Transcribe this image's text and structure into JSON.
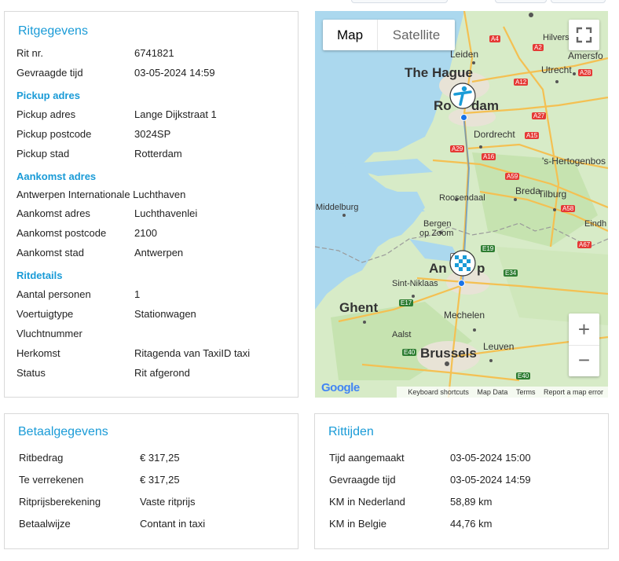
{
  "ritgegevens": {
    "title": "Ritgegevens",
    "rit_nr_label": "Rit nr.",
    "rit_nr": "6741821",
    "gevraagde_tijd_label": "Gevraagde tijd",
    "gevraagde_tijd": "03-05-2024 14:59",
    "pickup_heading": "Pickup adres",
    "pickup_adres_label": "Pickup adres",
    "pickup_adres": "Lange Dijkstraat 1",
    "pickup_postcode_label": "Pickup postcode",
    "pickup_postcode": "3024SP",
    "pickup_stad_label": "Pickup stad",
    "pickup_stad": "Rotterdam",
    "aankomst_heading": "Aankomst adres",
    "aankomst_naam": "Antwerpen Internationale Luchthaven",
    "aankomst_adres_label": "Aankomst adres",
    "aankomst_adres": "Luchthavenlei",
    "aankomst_postcode_label": "Aankomst postcode",
    "aankomst_postcode": "2100",
    "aankomst_stad_label": "Aankomst stad",
    "aankomst_stad": "Antwerpen",
    "ritdetails_heading": "Ritdetails",
    "aantal_personen_label": "Aantal personen",
    "aantal_personen": "1",
    "voertuigtype_label": "Voertuigtype",
    "voertuigtype": "Stationwagen",
    "vluchtnummer_label": "Vluchtnummer",
    "vluchtnummer": "",
    "herkomst_label": "Herkomst",
    "herkomst": "Ritagenda van TaxiID taxi",
    "status_label": "Status",
    "status": "Rit afgerond"
  },
  "map": {
    "map_button": "Map",
    "satellite_button": "Satellite",
    "fullscreen_icon": "fullscreen-icon",
    "zoom_in": "+",
    "zoom_out": "−",
    "google_logo": "Google",
    "attribution": [
      "Keyboard shortcuts",
      "Map Data",
      "Terms",
      "Report a map error"
    ],
    "labels": {
      "leiden": "Leiden",
      "the_hague": "The Hague",
      "rotterdam_a": "Ro",
      "rotterdam_b": "dam",
      "dordrecht": "Dordrecht",
      "utrecht": "Utrecht",
      "hilversum": "Hilvers",
      "amersfoort": "Amersfo",
      "hertogenbosch": "'s-Hertogenbos",
      "breda": "Breda",
      "tilburg": "Tilburg",
      "middelburg": "Middelburg",
      "roosendaal": "Roosendaal",
      "bergen": "Bergen",
      "op_zoom": "op Zoom",
      "eindhoven": "Eindh",
      "antwerp_a": "An",
      "antwerp_b": "p",
      "sint_niklaas": "Sint-Niklaas",
      "ghent": "Ghent",
      "mechelen": "Mechelen",
      "aalst": "Aalst",
      "brussels": "Brussels",
      "leuven": "Leuven"
    },
    "shields": [
      "A4",
      "A2",
      "A12",
      "A27",
      "A28",
      "A15",
      "A29",
      "A16",
      "A59",
      "A58",
      "A67",
      "E19",
      "E34",
      "E17",
      "E40",
      "E40",
      "A1"
    ],
    "pickup_marker_icon": "taxi-person-icon",
    "dest_marker_icon": "checkered-flag-icon"
  },
  "betaalgegevens": {
    "title": "Betaalgegevens",
    "ritbedrag_label": "Ritbedrag",
    "ritbedrag": "€ 317,25",
    "te_verrekenen_label": "Te verrekenen",
    "te_verrekenen": "€ 317,25",
    "ritprijs_label": "Ritprijsberekening",
    "ritprijs": "Vaste ritprijs",
    "betaalwijze_label": "Betaalwijze",
    "betaalwijze": "Contant in taxi"
  },
  "rittijden": {
    "title": "Rittijden",
    "tijd_aangemaakt_label": "Tijd aangemaakt",
    "tijd_aangemaakt": "03-05-2024 15:00",
    "gevraagde_tijd_label": "Gevraagde tijd",
    "gevraagde_tijd": "03-05-2024 14:59",
    "km_nl_label": "KM in Nederland",
    "km_nl": "58,89 km",
    "km_be_label": "KM in Belgie",
    "km_be": "44,76 km"
  }
}
